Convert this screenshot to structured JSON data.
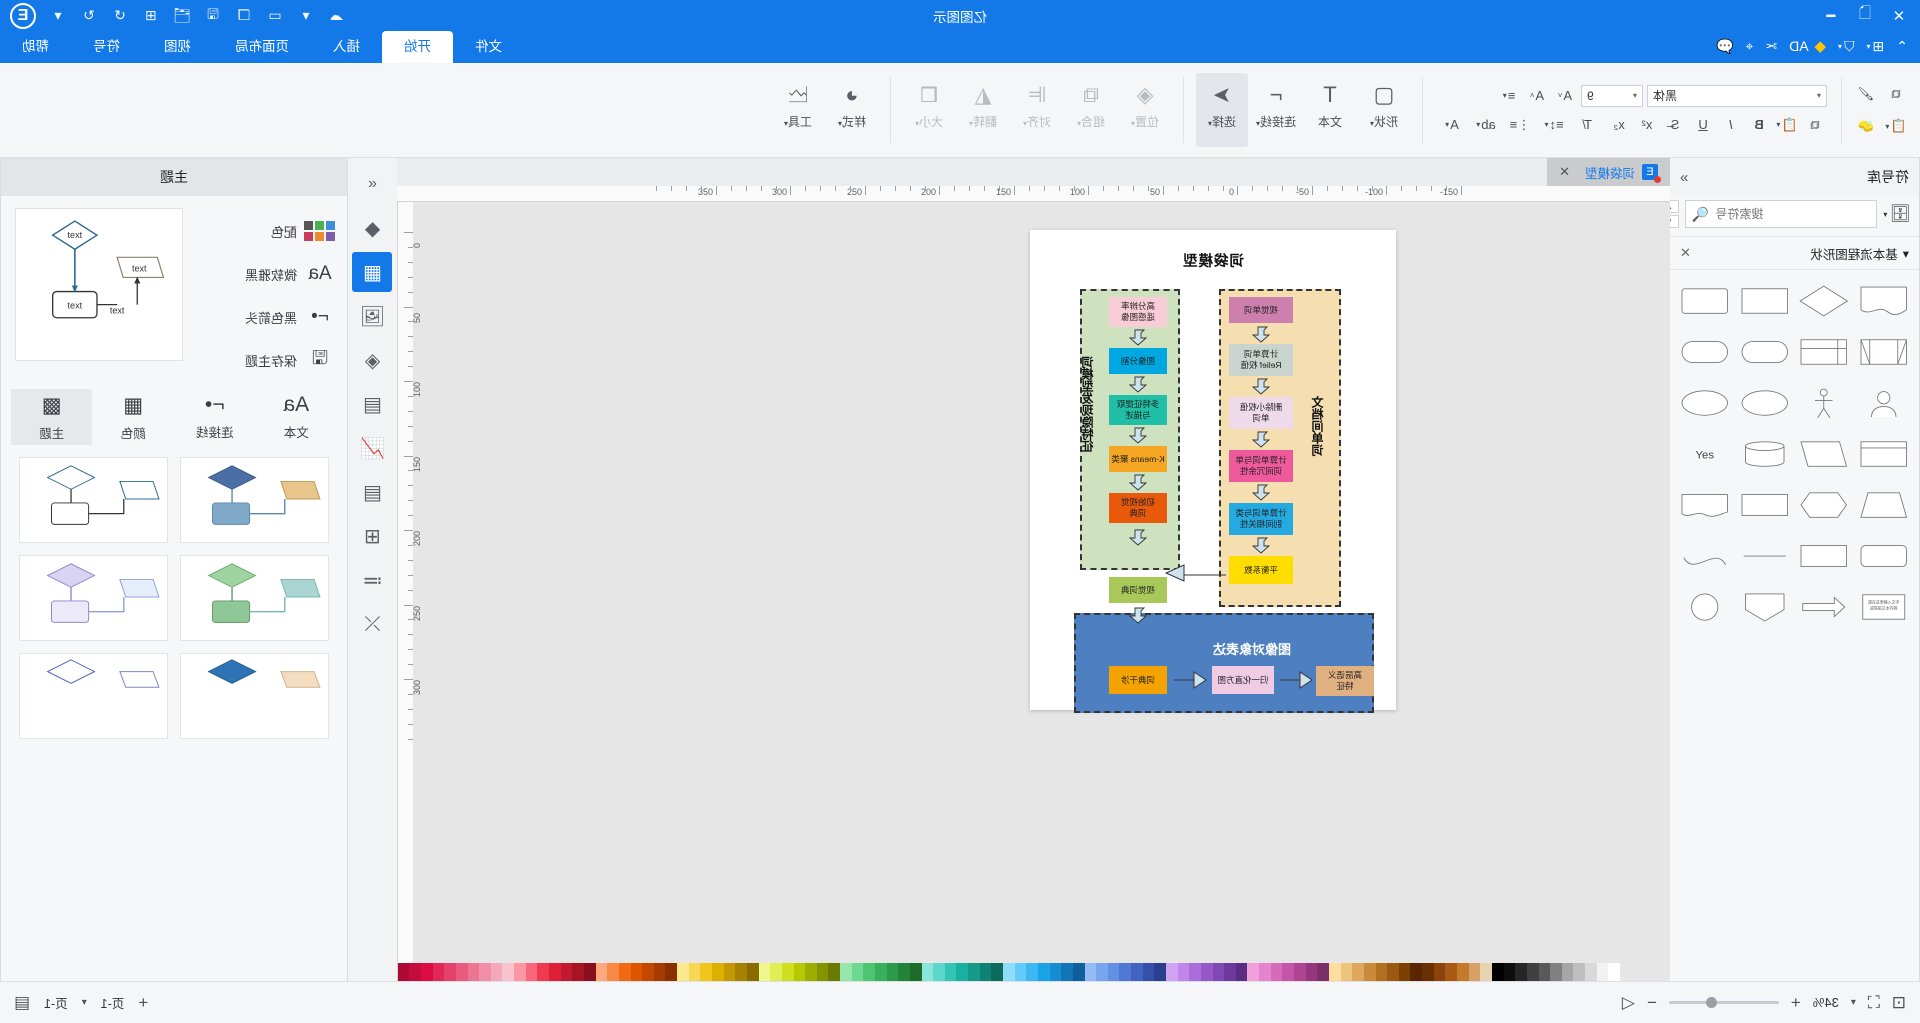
{
  "app": {
    "title": "亿图图示",
    "logo_letter": "E"
  },
  "titlebar": {
    "left_icons": [
      "close-x-icon",
      "new-doc-icon",
      "minimize-icon"
    ],
    "right_icons": [
      "cloud-sync-icon",
      "layout-grid-icon",
      "save-icon",
      "open-folder-icon",
      "add-icon",
      "undo-icon",
      "redo-icon"
    ]
  },
  "menubar": {
    "quick_items": [
      {
        "icon": "chevron-up-icon",
        "label": ""
      },
      {
        "icon": "apps-grid-icon",
        "label": ""
      },
      {
        "icon": "shield-icon",
        "label": ""
      },
      {
        "icon": "ad-icon",
        "label": "AD"
      },
      {
        "icon": "scissors-icon",
        "label": ""
      },
      {
        "icon": "cursor-icon",
        "label": ""
      },
      {
        "icon": "comment-icon",
        "label": ""
      }
    ],
    "tabs": [
      {
        "label": "文件",
        "active": false
      },
      {
        "label": "开始",
        "active": true
      },
      {
        "label": "插入",
        "active": false
      },
      {
        "label": "页面布局",
        "active": false
      },
      {
        "label": "视图",
        "active": false
      },
      {
        "label": "符号",
        "active": false
      },
      {
        "label": "帮助",
        "active": false
      }
    ]
  },
  "ribbon": {
    "groups": [
      {
        "buttons": [
          {
            "label": "形状",
            "icon": "square-shape-icon",
            "dropdown": true,
            "dim": false,
            "selected": false
          },
          {
            "label": "文本",
            "icon": "text-T-icon",
            "dropdown": false,
            "dim": false,
            "selected": false
          },
          {
            "label": "连接线",
            "icon": "connector-icon",
            "dropdown": true,
            "dim": false,
            "selected": false
          },
          {
            "label": "选择",
            "icon": "arrow-select-icon",
            "dropdown": true,
            "dim": false,
            "selected": true
          }
        ]
      },
      {
        "buttons": [
          {
            "label": "位置",
            "icon": "layers-icon",
            "dropdown": true,
            "dim": true,
            "selected": false
          },
          {
            "label": "组合",
            "icon": "group-icon",
            "dropdown": true,
            "dim": true,
            "selected": false
          },
          {
            "label": "对齐",
            "icon": "align-icon",
            "dropdown": true,
            "dim": true,
            "selected": false
          },
          {
            "label": "翻转",
            "icon": "flip-icon",
            "dropdown": true,
            "dim": true,
            "selected": false
          },
          {
            "label": "大小",
            "icon": "size-icon",
            "dropdown": true,
            "dim": true,
            "selected": false
          }
        ]
      },
      {
        "buttons": [
          {
            "label": "样式",
            "icon": "fill-bucket-icon",
            "dropdown": true,
            "dim": false,
            "selected": false
          },
          {
            "label": "工具",
            "icon": "tools-icon",
            "dropdown": true,
            "dim": false,
            "selected": false
          }
        ]
      }
    ],
    "font": {
      "family_value": "黑体",
      "size_value": "9",
      "buttons_row1": [
        "font-color-A-icon",
        "grow-font-icon",
        "shrink-font-icon",
        "list-indent-icon"
      ],
      "buttons_row2": [
        "bold-B-icon",
        "italic-I-icon",
        "underline-U-icon",
        "strikethrough-S-icon",
        "clear-format-icon",
        "superscript-icon",
        "subscript-icon",
        "line-spacing-icon",
        "bullets-icon",
        "highlight-icon",
        "text-align-A-icon"
      ],
      "clipboard_icons": [
        "copy-icon",
        "paste-icon"
      ],
      "right_icons": [
        "format-painter-icon",
        "eraser-icon"
      ]
    }
  },
  "left_panel": {
    "header": "主题",
    "options": [
      {
        "label": "配色",
        "icon": "color-swatch-icon"
      },
      {
        "label": "微软雅黑",
        "icon": "font-Aa-icon"
      },
      {
        "label": "黑色箭头",
        "icon": "connector-arrow-icon"
      },
      {
        "label": "保存主题",
        "icon": "floppy-save-icon"
      }
    ],
    "tabs": [
      {
        "label": "主题",
        "icon": "theme-grid-icon",
        "active": true
      },
      {
        "label": "颜色",
        "icon": "color-table-icon",
        "active": false
      },
      {
        "label": "连接线",
        "icon": "connector-icon",
        "active": false
      },
      {
        "label": "文本",
        "icon": "font-Aa-icon",
        "active": false
      }
    ],
    "preview_labels": [
      "text",
      "text",
      "text",
      "text"
    ]
  },
  "rail": {
    "items": [
      {
        "name": "collapse-chevrons-icon",
        "active": false
      },
      {
        "name": "fill-style-icon",
        "active": false
      },
      {
        "name": "theme-grid-icon",
        "active": true
      },
      {
        "name": "image-icon",
        "active": false
      },
      {
        "name": "layers-icon",
        "active": false
      },
      {
        "name": "pages-icon",
        "active": false
      },
      {
        "name": "chart-icon",
        "active": false
      },
      {
        "name": "table-icon",
        "active": false
      },
      {
        "name": "container-icon",
        "active": false
      },
      {
        "name": "align-list-icon",
        "active": false
      },
      {
        "name": "shuffle-icon",
        "active": false
      }
    ]
  },
  "canvas": {
    "doc_tab": "词袋模型",
    "close_label": "✕",
    "ruler_h_labels": [
      "-150",
      "-100",
      "-50",
      "0",
      "50",
      "100",
      "150",
      "200",
      "250",
      "300",
      "350"
    ],
    "ruler_v_labels": [
      "0",
      "50",
      "100",
      "150",
      "200",
      "250",
      "300"
    ]
  },
  "diagram": {
    "title": "词袋模型",
    "groups": [
      {
        "name": "orange-group",
        "label": "文档间单词",
        "color": "#f5dfb0"
      },
      {
        "name": "green-group",
        "label": "词模型发现隐特征",
        "color": "#cfe2c0"
      },
      {
        "name": "blue-group",
        "label": "图像对象表达",
        "color": "#4e7fc1"
      }
    ],
    "orange_nodes": [
      {
        "text": "视觉单词",
        "bg": "#cd7fad"
      },
      {
        "text": "计算单词\nRelief 权值",
        "bg": "#c9d4ce"
      },
      {
        "text": "删除小权值\n单词",
        "bg": "#eedaea"
      },
      {
        "text": "计算单词与单\n词间冗余性",
        "bg": "#ef5a9c"
      },
      {
        "text": "计算单词与类\n别间相关性",
        "bg": "#24a9e0"
      },
      {
        "text": "平衡系数",
        "bg": "#ffdd00"
      }
    ],
    "green_nodes": [
      {
        "text": "高分辨率\n遥感图像",
        "bg": "#f9cdd8"
      },
      {
        "text": "图像分割",
        "bg": "#00a7e1"
      },
      {
        "text": "多特征提取\n与描述",
        "bg": "#20c0a8"
      },
      {
        "text": "K-means 聚类",
        "bg": "#f5a623"
      },
      {
        "text": "初始视觉\n词典",
        "bg": "#e8590c"
      }
    ],
    "blue_nodes": [
      {
        "text": "视觉词典",
        "bg": "#a8c95a"
      },
      {
        "text": "词典干涉",
        "bg": "#f5a300"
      },
      {
        "text": "归一化直方图",
        "bg": "#f0cbe4"
      },
      {
        "text": "高层语义\n特征",
        "bg": "#e0b080"
      }
    ],
    "blue_title": "图像对象表达"
  },
  "right_panel": {
    "header": "符号库",
    "search_placeholder": "搜索符号",
    "section_title": "基本流程图形状",
    "close_label": "✕",
    "shapes": [
      "document-wave",
      "diamond",
      "rectangle",
      "rounded-rect",
      "double-bar",
      "internal-storage",
      "stadium",
      "stadium2",
      "user-head",
      "person",
      "ellipse",
      "ellipse2",
      "sheet",
      "parallelogram",
      "cylinder",
      "yes-label",
      "trapezoid",
      "hexagon",
      "rect-plain",
      "wave-rect",
      "rounded-box",
      "rect2",
      "line-shape",
      "curve-shape",
      "note-text",
      "left-arrow",
      "pentagon-down",
      "circle-plain"
    ],
    "shape_label_yes": "Yes",
    "note_text": "请在这里输入文字或粘贴文本内容"
  },
  "status_bar": {
    "left_icons": [
      "fit-page-icon",
      "fullscreen-icon"
    ],
    "zoom_value": "34%",
    "zoom_minus": "−",
    "zoom_plus": "+",
    "play_icon": "play-icon",
    "page_label": "页-1",
    "page_add": "+",
    "page_current": "页-1",
    "page_view_icon": "page-view-icon"
  },
  "colors": {
    "accent": "#1379e8",
    "ribbon_bg": "#f5f6f7",
    "canvas_bg": "#e6e6e6",
    "palette_strip": [
      "#ffffff",
      "#f2f2f2",
      "#d9d9d9",
      "#bfbfbf",
      "#a6a6a6",
      "#808080",
      "#595959",
      "#404040",
      "#262626",
      "#0d0d0d",
      "#000000",
      "#e8d3b0",
      "#d9a066",
      "#c47a2b",
      "#a85a12",
      "#8c4208",
      "#6b3000",
      "#5a2500",
      "#7b3f00",
      "#9c5a10",
      "#b07020",
      "#c98a3a",
      "#e0a85c",
      "#f0c37d",
      "#ffdca0",
      "#7a2f6b",
      "#95377f",
      "#b04494",
      "#c455a8",
      "#d66bbb",
      "#e584cd",
      "#f29fdd",
      "#5a2d82",
      "#6d3a9c",
      "#8148b5",
      "#9657c9",
      "#ab6ddb",
      "#c086e8",
      "#d4a2f2",
      "#2b3f8f",
      "#3550a8",
      "#4263c0",
      "#5078d4",
      "#6290e2",
      "#78a6ee",
      "#93bcf6",
      "#0f5f9c",
      "#1275b8",
      "#168cd2",
      "#1ba3e8",
      "#3bb8f2",
      "#62cbf8",
      "#8eddfb",
      "#0d6b5e",
      "#108274",
      "#14998a",
      "#18b0a0",
      "#35c5b5",
      "#5dd7c9",
      "#8ae5db",
      "#1e6b2a",
      "#25823a",
      "#2d994a",
      "#36b05b",
      "#4dc673",
      "#6fd890",
      "#96e7ae",
      "#6b7a00",
      "#849400",
      "#9cae00",
      "#b5c800",
      "#cddf1f",
      "#dfee55",
      "#eef78e",
      "#8a6b00",
      "#a68200",
      "#c29900",
      "#ddb000",
      "#f0c51c",
      "#f8d757",
      "#fde88e",
      "#8a2f00",
      "#a63b00",
      "#c24800",
      "#dd5500",
      "#f06a14",
      "#f88a45",
      "#fda97d",
      "#8a0f1e",
      "#a61426",
      "#c2192f",
      "#dd2038",
      "#f03a50",
      "#f8677a",
      "#fd95a3",
      "#f7c3cf",
      "#f4a9bb",
      "#f08fa7",
      "#ec7593",
      "#e85b7f",
      "#e4416b",
      "#e02757",
      "#dc0d43",
      "#c50b3c",
      "#ae0a35"
    ]
  }
}
